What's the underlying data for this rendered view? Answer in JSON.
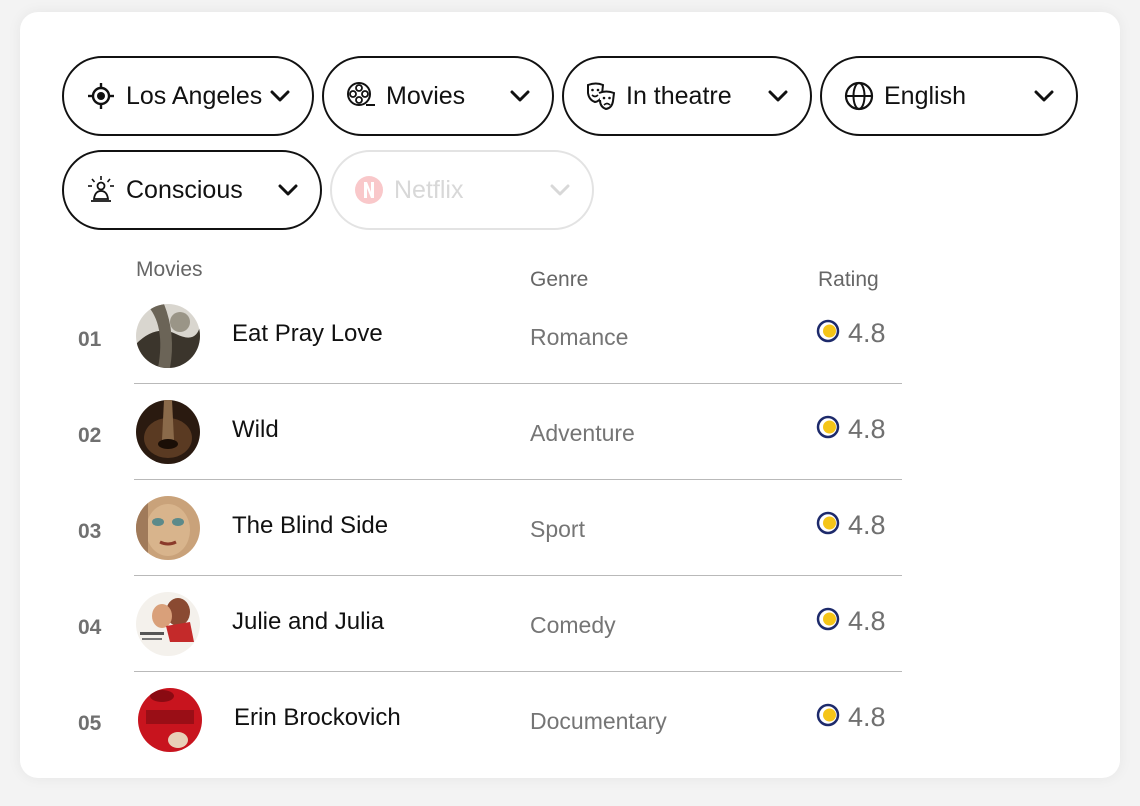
{
  "filters": [
    {
      "label": "Los Angeles",
      "icon": "location-target-icon",
      "enabled": true
    },
    {
      "label": "Movies",
      "icon": "film-reel-icon",
      "enabled": true
    },
    {
      "label": "In theatre",
      "icon": "theatre-masks-icon",
      "enabled": true
    },
    {
      "label": "English",
      "icon": "globe-icon",
      "enabled": true
    },
    {
      "label": "Conscious",
      "icon": "meditation-person-icon",
      "enabled": true
    },
    {
      "label": "Netflix",
      "icon": "netflix-logo-icon",
      "enabled": false
    }
  ],
  "table": {
    "headers": {
      "movies": "Movies",
      "genre": "Genre",
      "rating": "Rating"
    },
    "rows": [
      {
        "num": "01",
        "title": "Eat Pray Love",
        "genre": "Romance",
        "rating": "4.8"
      },
      {
        "num": "02",
        "title": "Wild",
        "genre": "Adventure",
        "rating": "4.8"
      },
      {
        "num": "03",
        "title": "The Blind Side",
        "genre": "Sport",
        "rating": "4.8"
      },
      {
        "num": "04",
        "title": "Julie and Julia",
        "genre": "Comedy",
        "rating": "4.8"
      },
      {
        "num": "05",
        "title": "Erin Brockovich",
        "genre": "Documentary",
        "rating": "4.8"
      }
    ]
  },
  "colors": {
    "border": "#111111",
    "disabled_border": "#e3e3e3",
    "rating_ring": "#1d2a6b",
    "rating_fill": "#f5c518",
    "netflix_red": "#e50914"
  }
}
